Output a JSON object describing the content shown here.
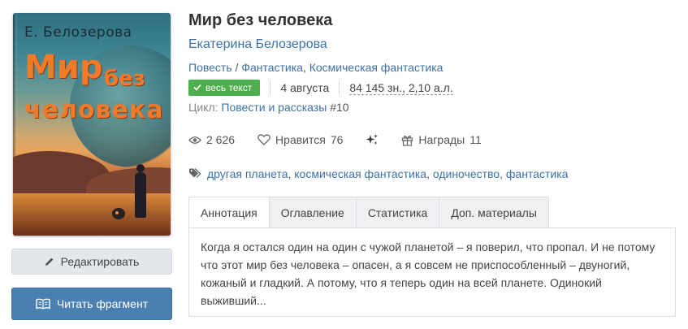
{
  "cover": {
    "author_text": "Е. Белозерова",
    "title_line1": "Мир",
    "title_line2": "без",
    "title_line3": "человека"
  },
  "actions": {
    "edit_label": "Редактировать",
    "read_label": "Читать фрагмент"
  },
  "book": {
    "title": "Мир без человека",
    "author": "Екатерина Белозерова",
    "form": "Повесть",
    "genres_sep": " / ",
    "genres": [
      "Фантастика",
      "Космическая фантастика"
    ],
    "status_badge": "весь текст",
    "date": "4 августа",
    "size": "84 145 зн., 2,10 а.л.",
    "series_label": "Цикл:",
    "series_name": "Повести и рассказы",
    "series_num": "#10"
  },
  "stats": {
    "views": "2 626",
    "likes_label": "Нравится",
    "likes": "76",
    "awards_label": "Награды",
    "awards": "11"
  },
  "tags": [
    "другая планета",
    "космическая фантастика",
    "одиночество",
    "фантастика"
  ],
  "tabs": [
    "Аннотация",
    "Оглавление",
    "Статистика",
    "Доп. материалы"
  ],
  "annotation": "Когда я остался один на один с чужой планетой – я поверил, что пропал. И не потому что этот мир без человека – опасен, а я совсем не приспособленный – двуногий, кожаный и гладкий. А потому, что я теперь один на всей планете. Одинокий выживший...",
  "colors": {
    "link": "#3c72a9",
    "badge": "#4cae4c",
    "read_button": "#4a80b1",
    "edit_button": "#e3e7ec"
  }
}
